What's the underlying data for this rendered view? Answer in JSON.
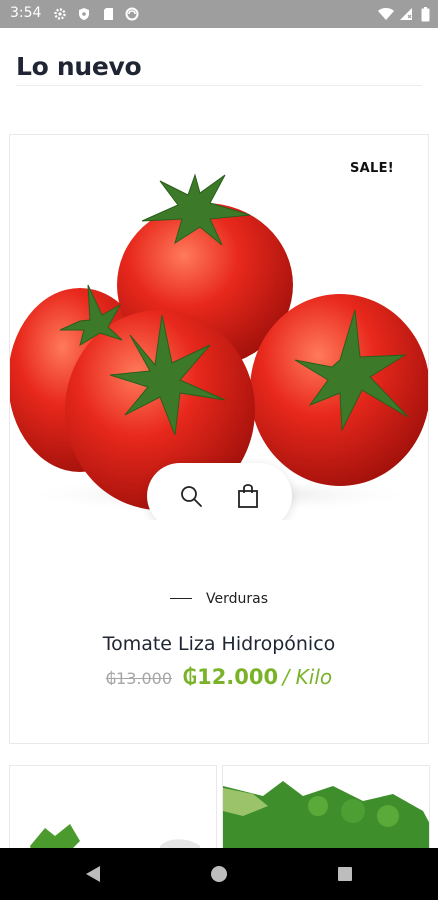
{
  "status_bar": {
    "time": "3:54",
    "icons": [
      "gear-icon",
      "shield-icon",
      "sim-card-icon",
      "no-disturb-icon",
      "wifi-icon",
      "signal-icon",
      "battery-icon"
    ]
  },
  "section": {
    "title": "Lo nuevo"
  },
  "product": {
    "badge": "SALE!",
    "category": "Verduras",
    "name": "Tomate Liza Hidropónico",
    "old_price": "₲13.000",
    "price": "₲12.000",
    "unit": "/ Kilo",
    "actions": [
      "search-icon",
      "shopping-bag-icon"
    ]
  },
  "colors": {
    "accent": "#7ab329",
    "title": "#1f2533",
    "status_bar": "#9e9e9e",
    "nav_bar": "#000000"
  },
  "nav": {
    "buttons": [
      "back-icon",
      "home-icon",
      "recents-icon"
    ]
  }
}
